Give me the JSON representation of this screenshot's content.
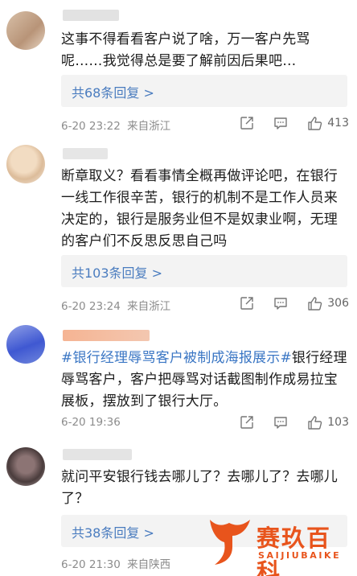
{
  "comments": [
    {
      "text": "这事不得看看客户说了啥，万一客户先骂呢……我觉得总是要了解前因后果吧…",
      "reply_label": "共68条回复 >",
      "time": "6-20 23:22",
      "location": "来自浙江",
      "likes": "413",
      "avatar_color": "#c9a98c"
    },
    {
      "text": "断章取义？看看事情全概再做评论吧，在银行一线工作很辛苦，银行的机制不是工作人员来决定的，银行是服务业但不是奴隶业啊，无理的客户们不反思反思自己吗",
      "reply_label": "共103条回复 >",
      "time": "6-20 23:24",
      "location": "来自浙江",
      "likes": "306",
      "avatar_color": "#e4c7a6"
    },
    {
      "topic": "#银行经理辱骂客户被制成海报展示#",
      "text": "银行经理辱骂客户，客户把辱骂对话截图制作成易拉宝展板，摆放到了银行大厅。",
      "time": "6-20 19:36",
      "likes": "103",
      "avatar_color": "#5a72d6"
    },
    {
      "text": "就问平安银行钱去哪儿了？去哪儿了？去哪儿了？",
      "reply_label": "共38条回复 >",
      "time": "6-20 21:30",
      "location": "来自陕西",
      "avatar_color": "#6c5a5a"
    }
  ],
  "watermark": {
    "title": "赛玖百科",
    "subtitle": "SAIJIUBAIKE",
    "color": "#e8541c"
  },
  "icons": [
    "share-icon",
    "comment-icon",
    "like-icon"
  ]
}
